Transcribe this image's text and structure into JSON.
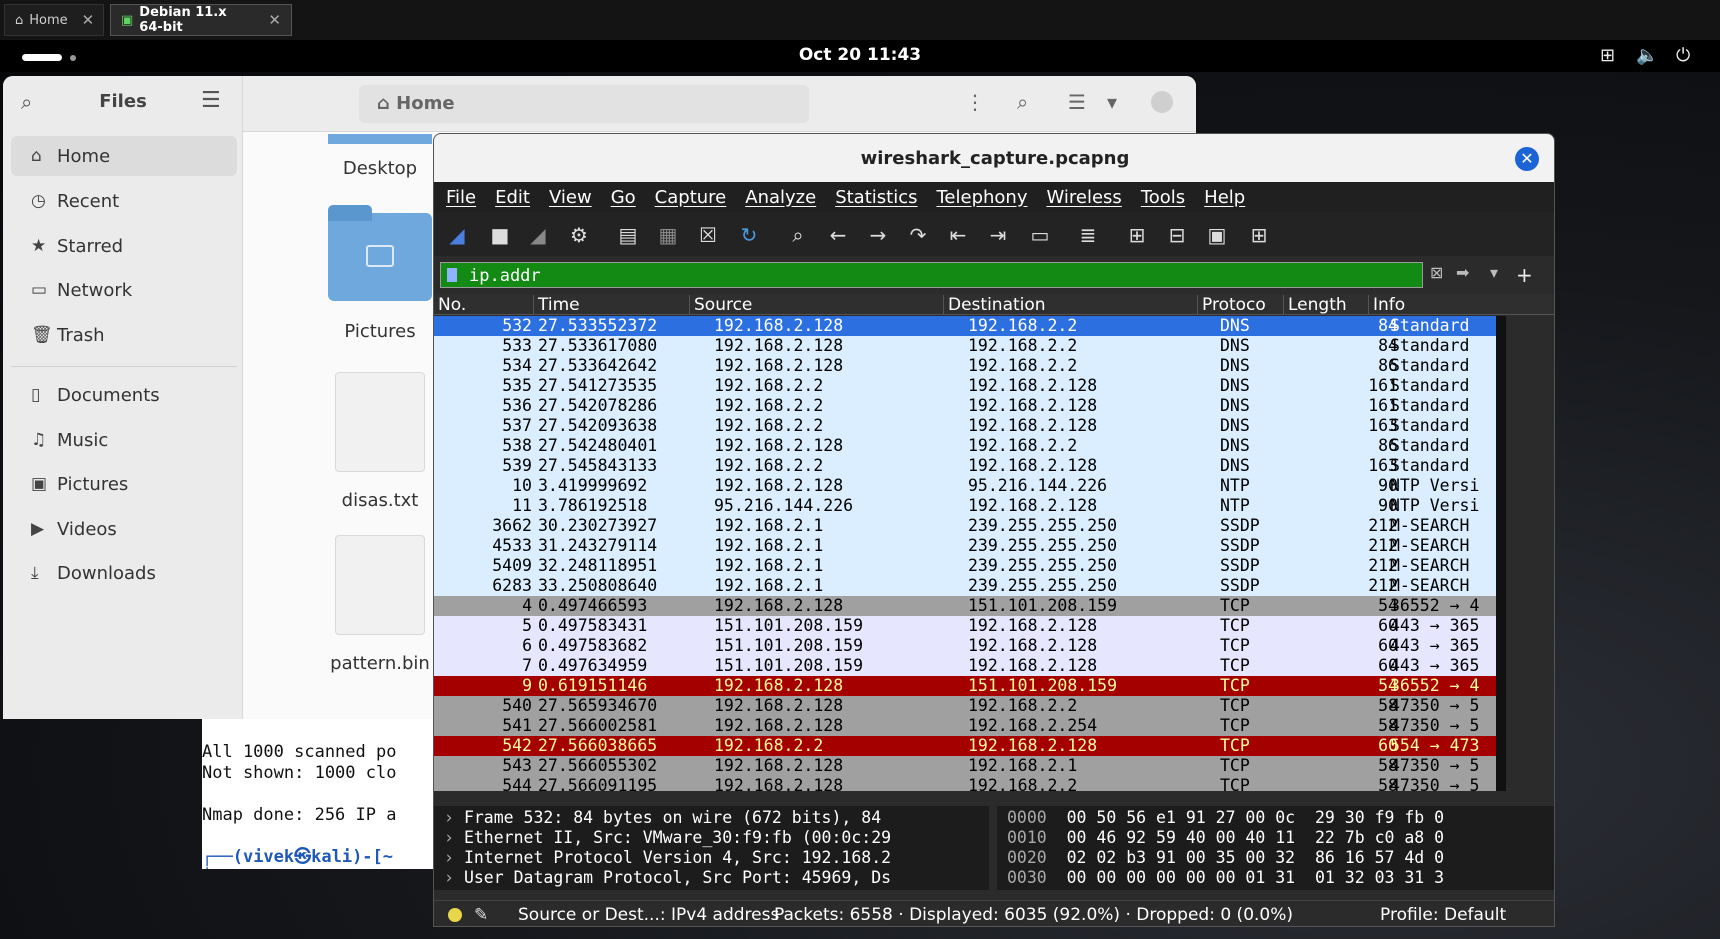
{
  "vm": {
    "tabs": [
      {
        "label": "Home"
      },
      {
        "label": "Debian 11.x 64-bit"
      }
    ]
  },
  "topbar": {
    "clock": "Oct 20  11:43"
  },
  "files": {
    "title": "Files",
    "location": "Home",
    "sidebar": [
      {
        "label": "Home",
        "icon": "home-icon"
      },
      {
        "label": "Recent",
        "icon": "clock-icon"
      },
      {
        "label": "Starred",
        "icon": "star-icon"
      },
      {
        "label": "Network",
        "icon": "network-icon"
      },
      {
        "label": "Trash",
        "icon": "trash-icon"
      },
      {
        "label": "Documents",
        "icon": "document-icon"
      },
      {
        "label": "Music",
        "icon": "music-icon"
      },
      {
        "label": "Pictures",
        "icon": "picture-icon"
      },
      {
        "label": "Videos",
        "icon": "video-icon"
      },
      {
        "label": "Downloads",
        "icon": "download-icon"
      }
    ],
    "items": [
      {
        "label": "Desktop"
      },
      {
        "label": "Pictures"
      },
      {
        "label": "disas.txt"
      },
      {
        "label": "pattern.bin"
      }
    ]
  },
  "terminal": {
    "lines": [
      "All 1000 scanned po",
      "Not shown: 1000 clo",
      "",
      "Nmap done: 256 IP a",
      ""
    ],
    "prompt_user": "(vivek㉿kali)-[~",
    "prompt_symbol": "$"
  },
  "wireshark": {
    "title": "wireshark_capture.pcapng",
    "menu": [
      "File",
      "Edit",
      "View",
      "Go",
      "Capture",
      "Analyze",
      "Statistics",
      "Telephony",
      "Wireless",
      "Tools",
      "Help"
    ],
    "filter": "ip.addr",
    "columns": {
      "no": "No.",
      "time": "Time",
      "source": "Source",
      "destination": "Destination",
      "protocol": "Protoco",
      "length": "Length",
      "info": "Info"
    },
    "packets": [
      {
        "no": "532",
        "time": "27.533552372",
        "src": "192.168.2.128",
        "dst": "192.168.2.2",
        "proto": "DNS",
        "len": "84",
        "info": "Standard",
        "bg": "#2b6fe0",
        "fg": "#ffffff"
      },
      {
        "no": "533",
        "time": "27.533617080",
        "src": "192.168.2.128",
        "dst": "192.168.2.2",
        "proto": "DNS",
        "len": "84",
        "info": "Standard",
        "bg": "#daeeff",
        "fg": "#000000"
      },
      {
        "no": "534",
        "time": "27.533642642",
        "src": "192.168.2.128",
        "dst": "192.168.2.2",
        "proto": "DNS",
        "len": "86",
        "info": "Standard",
        "bg": "#daeeff",
        "fg": "#000000"
      },
      {
        "no": "535",
        "time": "27.541273535",
        "src": "192.168.2.2",
        "dst": "192.168.2.128",
        "proto": "DNS",
        "len": "161",
        "info": "Standard",
        "bg": "#daeeff",
        "fg": "#000000"
      },
      {
        "no": "536",
        "time": "27.542078286",
        "src": "192.168.2.2",
        "dst": "192.168.2.128",
        "proto": "DNS",
        "len": "161",
        "info": "Standard",
        "bg": "#daeeff",
        "fg": "#000000"
      },
      {
        "no": "537",
        "time": "27.542093638",
        "src": "192.168.2.2",
        "dst": "192.168.2.128",
        "proto": "DNS",
        "len": "163",
        "info": "Standard",
        "bg": "#daeeff",
        "fg": "#000000"
      },
      {
        "no": "538",
        "time": "27.542480401",
        "src": "192.168.2.128",
        "dst": "192.168.2.2",
        "proto": "DNS",
        "len": "86",
        "info": "Standard",
        "bg": "#daeeff",
        "fg": "#000000"
      },
      {
        "no": "539",
        "time": "27.545843133",
        "src": "192.168.2.2",
        "dst": "192.168.2.128",
        "proto": "DNS",
        "len": "163",
        "info": "Standard",
        "bg": "#daeeff",
        "fg": "#000000"
      },
      {
        "no": "10",
        "time": "3.419999692",
        "src": "192.168.2.128",
        "dst": "95.216.144.226",
        "proto": "NTP",
        "len": "90",
        "info": "NTP Versi",
        "bg": "#daeeff",
        "fg": "#000000"
      },
      {
        "no": "11",
        "time": "3.786192518",
        "src": "95.216.144.226",
        "dst": "192.168.2.128",
        "proto": "NTP",
        "len": "90",
        "info": "NTP Versi",
        "bg": "#daeeff",
        "fg": "#000000"
      },
      {
        "no": "3662",
        "time": "30.230273927",
        "src": "192.168.2.1",
        "dst": "239.255.255.250",
        "proto": "SSDP",
        "len": "212",
        "info": "M-SEARCH",
        "bg": "#daeeff",
        "fg": "#000000"
      },
      {
        "no": "4533",
        "time": "31.243279114",
        "src": "192.168.2.1",
        "dst": "239.255.255.250",
        "proto": "SSDP",
        "len": "212",
        "info": "M-SEARCH",
        "bg": "#daeeff",
        "fg": "#000000"
      },
      {
        "no": "5409",
        "time": "32.248118951",
        "src": "192.168.2.1",
        "dst": "239.255.255.250",
        "proto": "SSDP",
        "len": "212",
        "info": "M-SEARCH",
        "bg": "#daeeff",
        "fg": "#000000"
      },
      {
        "no": "6283",
        "time": "33.250808640",
        "src": "192.168.2.1",
        "dst": "239.255.255.250",
        "proto": "SSDP",
        "len": "212",
        "info": "M-SEARCH",
        "bg": "#daeeff",
        "fg": "#000000"
      },
      {
        "no": "4",
        "time": "0.497466593",
        "src": "192.168.2.128",
        "dst": "151.101.208.159",
        "proto": "TCP",
        "len": "54",
        "info": "36552 → 4",
        "bg": "#a0a0a0",
        "fg": "#000000"
      },
      {
        "no": "5",
        "time": "0.497583431",
        "src": "151.101.208.159",
        "dst": "192.168.2.128",
        "proto": "TCP",
        "len": "60",
        "info": "443 → 365",
        "bg": "#e7e6ff",
        "fg": "#000000"
      },
      {
        "no": "6",
        "time": "0.497583682",
        "src": "151.101.208.159",
        "dst": "192.168.2.128",
        "proto": "TCP",
        "len": "60",
        "info": "443 → 365",
        "bg": "#e7e6ff",
        "fg": "#000000"
      },
      {
        "no": "7",
        "time": "0.497634959",
        "src": "151.101.208.159",
        "dst": "192.168.2.128",
        "proto": "TCP",
        "len": "60",
        "info": "443 → 365",
        "bg": "#e7e6ff",
        "fg": "#000000"
      },
      {
        "no": "9",
        "time": "0.619151146",
        "src": "192.168.2.128",
        "dst": "151.101.208.159",
        "proto": "TCP",
        "len": "54",
        "info": "36552 → 4",
        "bg": "#a40000",
        "fg": "#fffc9c"
      },
      {
        "no": "540",
        "time": "27.565934670",
        "src": "192.168.2.128",
        "dst": "192.168.2.2",
        "proto": "TCP",
        "len": "58",
        "info": "47350 → 5",
        "bg": "#a0a0a0",
        "fg": "#000000"
      },
      {
        "no": "541",
        "time": "27.566002581",
        "src": "192.168.2.128",
        "dst": "192.168.2.254",
        "proto": "TCP",
        "len": "58",
        "info": "47350 → 5",
        "bg": "#a0a0a0",
        "fg": "#000000"
      },
      {
        "no": "542",
        "time": "27.566038665",
        "src": "192.168.2.2",
        "dst": "192.168.2.128",
        "proto": "TCP",
        "len": "60",
        "info": "554 → 473",
        "bg": "#a40000",
        "fg": "#fffc9c"
      },
      {
        "no": "543",
        "time": "27.566055302",
        "src": "192.168.2.128",
        "dst": "192.168.2.1",
        "proto": "TCP",
        "len": "58",
        "info": "47350 → 5",
        "bg": "#a0a0a0",
        "fg": "#000000"
      },
      {
        "no": "544",
        "time": "27.566091195",
        "src": "192.168.2.128",
        "dst": "192.168.2.2",
        "proto": "TCP",
        "len": "58",
        "info": "47350 → 5",
        "bg": "#a0a0a0",
        "fg": "#000000"
      }
    ],
    "details": [
      "Frame 532: 84 bytes on wire (672 bits), 84",
      "Ethernet II, Src: VMware_30:f9:fb (00:0c:29",
      "Internet Protocol Version 4, Src: 192.168.2",
      "User Datagram Protocol, Src Port: 45969, Ds"
    ],
    "bytes": [
      {
        "offset": "0000",
        "hex": "00 50 56 e1 91 27 00 0c  29 30 f9 fb 0"
      },
      {
        "offset": "0010",
        "hex": "00 46 92 59 40 00 40 11  22 7b c0 a8 0"
      },
      {
        "offset": "0020",
        "hex": "02 02 b3 91 00 35 00 32  86 16 57 4d 0"
      },
      {
        "offset": "0030",
        "hex": "00 00 00 00 00 00 01 31  01 32 03 31 3"
      }
    ],
    "status": {
      "field": "Source or Dest...: IPv4 address",
      "packets": "Packets: 6558 · Displayed: 6035 (92.0%) · Dropped: 0 (0.0%)",
      "profile": "Profile: Default"
    }
  }
}
